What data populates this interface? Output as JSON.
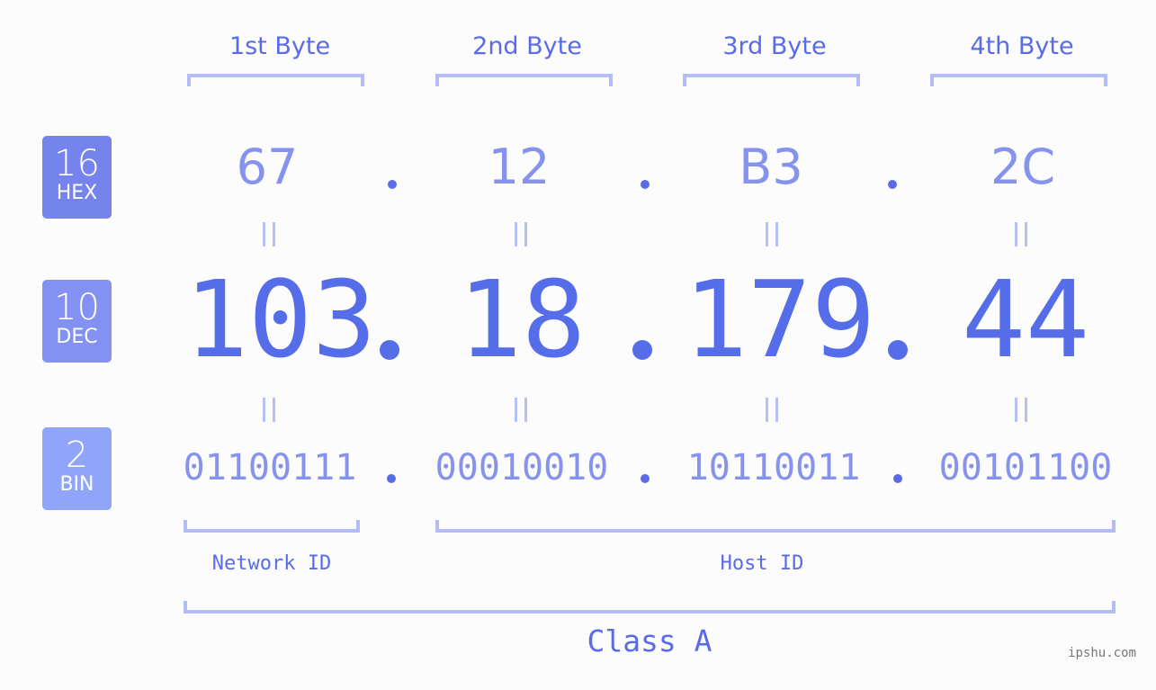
{
  "byte_headers": [
    "1st Byte",
    "2nd Byte",
    "3rd Byte",
    "4th Byte"
  ],
  "rows": {
    "hex": {
      "base": "16",
      "label": "HEX",
      "color": "#7583ec",
      "values": [
        "67",
        "12",
        "B3",
        "2C"
      ]
    },
    "dec": {
      "base": "10",
      "label": "DEC",
      "color": "#8391f2",
      "values": [
        "103",
        "18",
        "179",
        "44"
      ]
    },
    "bin": {
      "base": "2",
      "label": "BIN",
      "color": "#90a4fa",
      "values": [
        "01100111",
        "00010010",
        "10110011",
        "00101100"
      ]
    }
  },
  "separator": ".",
  "segments": {
    "network": "Network ID",
    "host": "Host ID"
  },
  "ip_class": "Class A",
  "watermark": "ipshu.com",
  "colors": {
    "accent": "#566de9",
    "light_accent": "#8592ee",
    "bracket": "#b3bcf7",
    "background": "#fbfcfb"
  }
}
